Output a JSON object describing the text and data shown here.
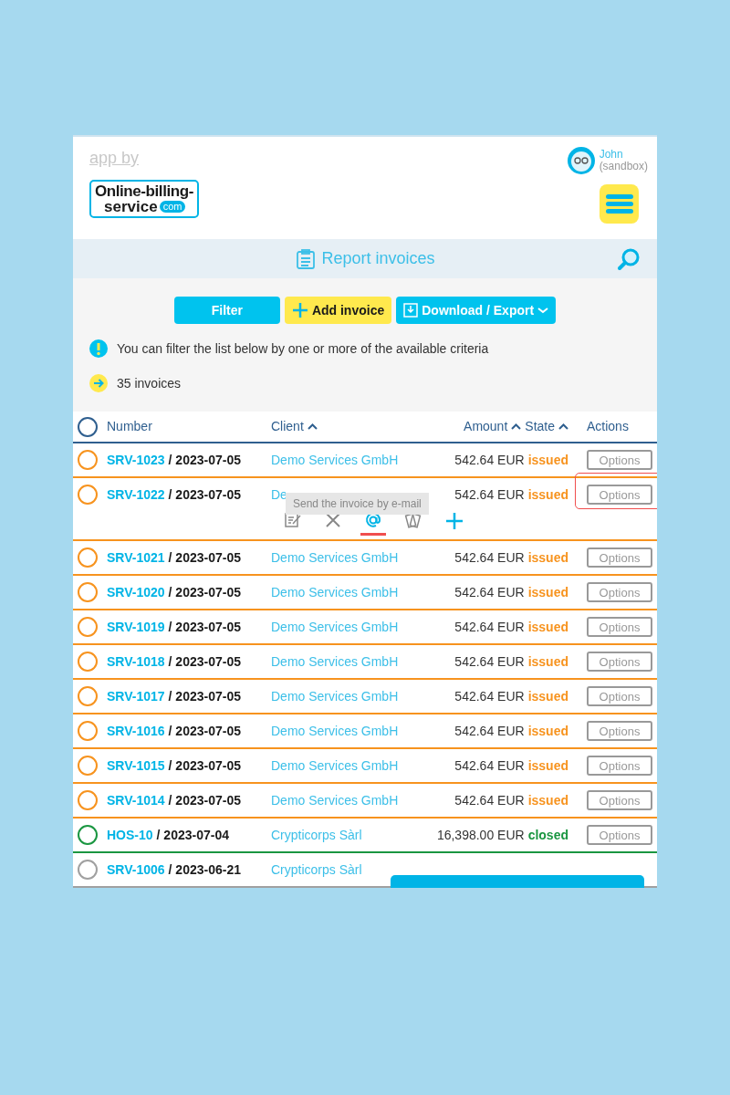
{
  "header": {
    "app_by": "app by",
    "logo": {
      "line_1": "Online-billing-",
      "line_2": "service",
      "badge": "com"
    },
    "user": {
      "name": "John",
      "account": "(sandbox)"
    }
  },
  "title_bar": {
    "title": "Report invoices"
  },
  "toolbar": {
    "buttons": [
      {
        "kind": "filter",
        "label": "Filter"
      },
      {
        "kind": "add",
        "label": "Add invoice"
      },
      {
        "kind": "export",
        "label": "Download / Export"
      }
    ]
  },
  "notices": [
    {
      "kind": "info",
      "text": "You can filter the list below by one or more of the available criteria"
    },
    {
      "kind": "count",
      "text": "35 invoices"
    }
  ],
  "table": {
    "columns": [
      {
        "label": "Number",
        "sorted": false
      },
      {
        "label": "Client",
        "sorted": true
      },
      {
        "label": "Amount",
        "sorted": true
      },
      {
        "label": "State",
        "sorted": true
      },
      {
        "label": "Actions",
        "sorted": false
      }
    ],
    "rows": [
      {
        "number": "SRV-1023",
        "date": "/ 2023-07-05",
        "client": "Demo Services GmbH",
        "amount": "542.64 EUR",
        "state": "issued",
        "color": "#f7931e",
        "action": "Options",
        "expanded": false
      },
      {
        "number": "SRV-1022",
        "date": "/ 2023-07-05",
        "client": "De",
        "amount": "542.64 EUR",
        "state": "issued",
        "color": "#f7931e",
        "action": "Options",
        "expanded": true,
        "highlighted": true,
        "tooltip": "Send the invoice by e-mail",
        "tools": [
          {
            "kind": "edit",
            "selected": false
          },
          {
            "kind": "delete",
            "selected": false
          },
          {
            "kind": "email",
            "selected": true
          },
          {
            "kind": "payment",
            "selected": false
          },
          {
            "kind": "add",
            "selected": false
          }
        ]
      },
      {
        "number": "SRV-1021",
        "date": "/ 2023-07-05",
        "client": "Demo Services GmbH",
        "amount": "542.64 EUR",
        "state": "issued",
        "color": "#f7931e",
        "action": "Options",
        "expanded": false
      },
      {
        "number": "SRV-1020",
        "date": "/ 2023-07-05",
        "client": "Demo Services GmbH",
        "amount": "542.64 EUR",
        "state": "issued",
        "color": "#f7931e",
        "action": "Options",
        "expanded": false
      },
      {
        "number": "SRV-1019",
        "date": "/ 2023-07-05",
        "client": "Demo Services GmbH",
        "amount": "542.64 EUR",
        "state": "issued",
        "color": "#f7931e",
        "action": "Options",
        "expanded": false
      },
      {
        "number": "SRV-1018",
        "date": "/ 2023-07-05",
        "client": "Demo Services GmbH",
        "amount": "542.64 EUR",
        "state": "issued",
        "color": "#f7931e",
        "action": "Options",
        "expanded": false
      },
      {
        "number": "SRV-1017",
        "date": "/ 2023-07-05",
        "client": "Demo Services GmbH",
        "amount": "542.64 EUR",
        "state": "issued",
        "color": "#f7931e",
        "action": "Options",
        "expanded": false
      },
      {
        "number": "SRV-1016",
        "date": "/ 2023-07-05",
        "client": "Demo Services GmbH",
        "amount": "542.64 EUR",
        "state": "issued",
        "color": "#f7931e",
        "action": "Options",
        "expanded": false
      },
      {
        "number": "SRV-1015",
        "date": "/ 2023-07-05",
        "client": "Demo Services GmbH",
        "amount": "542.64 EUR",
        "state": "issued",
        "color": "#f7931e",
        "action": "Options",
        "expanded": false
      },
      {
        "number": "SRV-1014",
        "date": "/ 2023-07-05",
        "client": "Demo Services GmbH",
        "amount": "542.64 EUR",
        "state": "issued",
        "color": "#f7931e",
        "action": "Options",
        "expanded": false
      },
      {
        "number": "HOS-10",
        "date": "/ 2023-07-04",
        "client": "Crypticorps Sàrl",
        "amount": "16,398.00 EUR",
        "state": "closed",
        "color": "#1a9641",
        "action": "Options",
        "expanded": false
      },
      {
        "number": "SRV-1006",
        "date": "/ 2023-06-21",
        "client": "Crypticorps Sàrl",
        "color": "#a0a0a0",
        "expanded": false
      }
    ]
  },
  "toast": {
    "shown": true
  }
}
